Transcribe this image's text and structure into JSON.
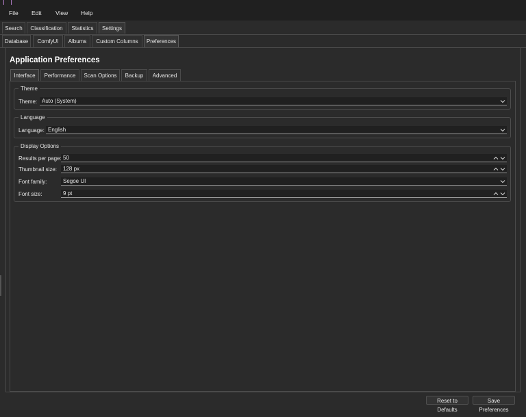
{
  "menu": [
    "File",
    "Edit",
    "View",
    "Help"
  ],
  "main_tabs": [
    "Search",
    "Classification",
    "Statistics",
    "Settings"
  ],
  "settings_tabs": [
    "Database",
    "ComfyUI",
    "Albums",
    "Custom Columns",
    "Preferences"
  ],
  "page": {
    "title": "Application Preferences"
  },
  "pref_tabs": [
    "Interface",
    "Performance",
    "Scan Options",
    "Backup",
    "Advanced"
  ],
  "theme_group": {
    "title": "Theme",
    "label": "Theme:",
    "value": "Auto (System)"
  },
  "language_group": {
    "title": "Language",
    "label": "Language:",
    "value": "English"
  },
  "display_group": {
    "title": "Display Options",
    "results_label": "Results per page:",
    "results_value": "50",
    "thumb_label": "Thumbnail size:",
    "thumb_value": "128 px",
    "font_family_label": "Font family:",
    "font_family_value": "Segoe UI",
    "font_size_label": "Font size:",
    "font_size_value": "9 pt"
  },
  "buttons": {
    "reset": "Reset to Defaults",
    "save": "Save Preferences"
  },
  "icons": {
    "dropdown": "chevron-down-icon",
    "spin_up": "chevron-up-icon",
    "spin_down": "chevron-down-icon"
  }
}
